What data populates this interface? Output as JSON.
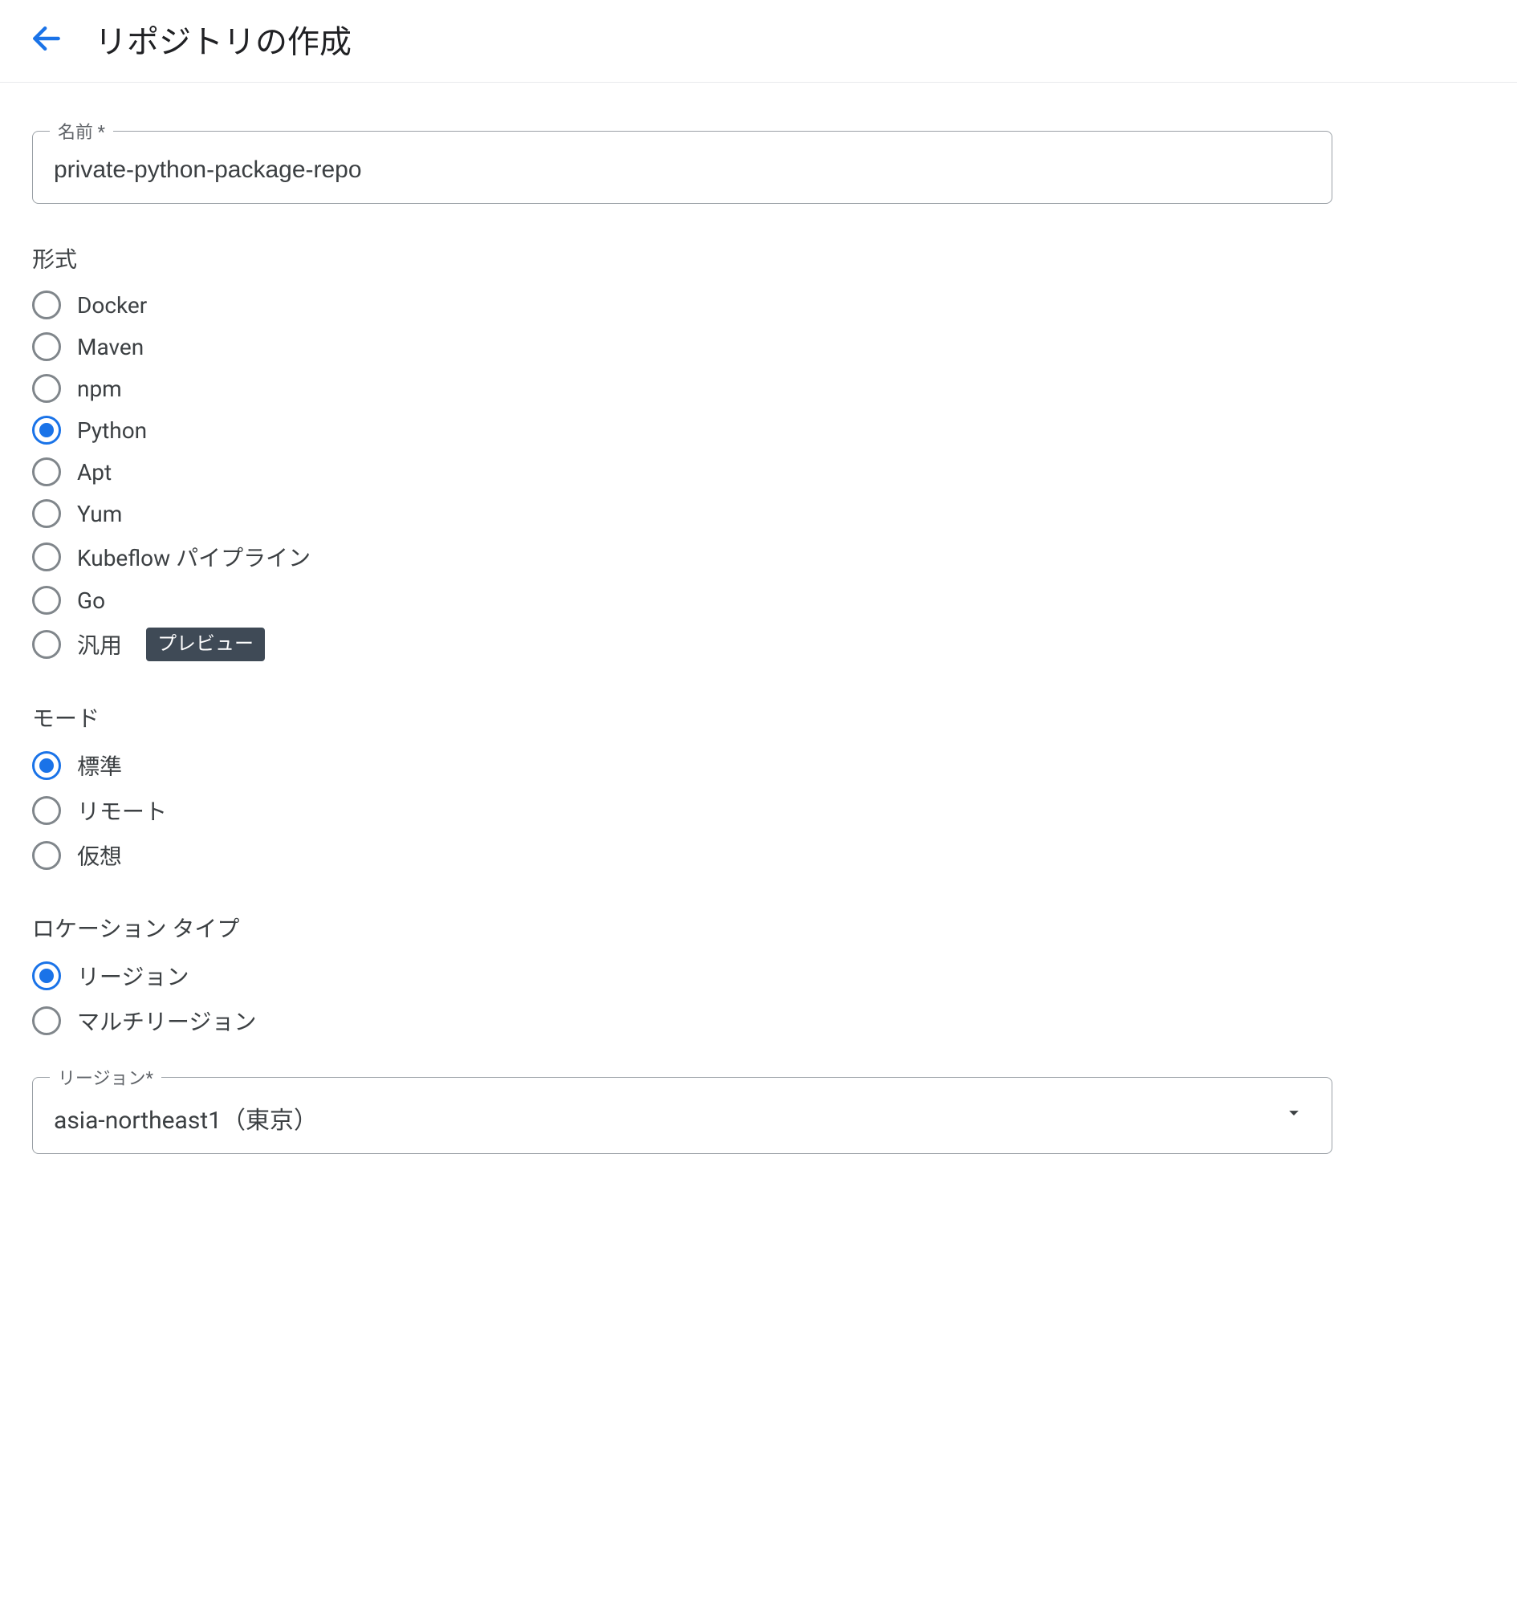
{
  "header": {
    "title": "リポジトリの作成"
  },
  "name_field": {
    "label": "名前 *",
    "value": "private-python-package-repo"
  },
  "format_section": {
    "label": "形式",
    "options": [
      {
        "label": "Docker",
        "selected": false,
        "badge": null
      },
      {
        "label": "Maven",
        "selected": false,
        "badge": null
      },
      {
        "label": "npm",
        "selected": false,
        "badge": null
      },
      {
        "label": "Python",
        "selected": true,
        "badge": null
      },
      {
        "label": "Apt",
        "selected": false,
        "badge": null
      },
      {
        "label": "Yum",
        "selected": false,
        "badge": null
      },
      {
        "label": "Kubeflow パイプライン",
        "selected": false,
        "badge": null
      },
      {
        "label": "Go",
        "selected": false,
        "badge": null
      },
      {
        "label": "汎用",
        "selected": false,
        "badge": "プレビュー"
      }
    ]
  },
  "mode_section": {
    "label": "モード",
    "options": [
      {
        "label": "標準",
        "selected": true
      },
      {
        "label": "リモート",
        "selected": false
      },
      {
        "label": "仮想",
        "selected": false
      }
    ]
  },
  "location_type_section": {
    "label": "ロケーション タイプ",
    "options": [
      {
        "label": "リージョン",
        "selected": true
      },
      {
        "label": "マルチリージョン",
        "selected": false
      }
    ]
  },
  "region_field": {
    "label": "リージョン*",
    "value": "asia-northeast1（東京）"
  },
  "colors": {
    "accent": "#1a73e8",
    "border": "#9aa0a6",
    "text": "#3c4043",
    "badge_bg": "#3f4a56"
  }
}
